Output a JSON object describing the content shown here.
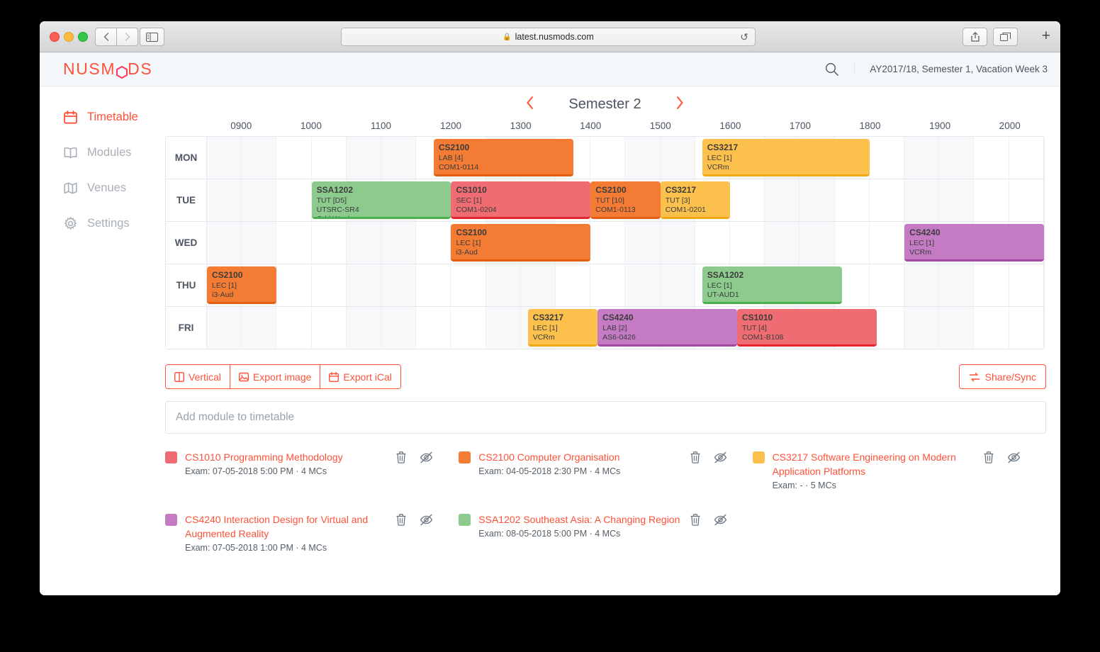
{
  "browser": {
    "url": "latest.nusmods.com",
    "lock_icon": "lock-icon",
    "reload_icon": "reload-icon",
    "back_icon": "back-arrow-icon",
    "forward_icon": "forward-arrow-icon",
    "sidebar_icon": "sidebar-toggle-icon",
    "share_icon": "share-icon",
    "tabs_icon": "show-tabs-icon",
    "new_tab_icon": "plus-icon"
  },
  "header": {
    "logo": "NUSMODS",
    "search_icon": "search-icon",
    "acad_info": "AY2017/18, Semester 1, Vacation Week 3"
  },
  "sidebar": {
    "items": [
      {
        "label": "Timetable",
        "icon": "calendar-icon",
        "active": true
      },
      {
        "label": "Modules",
        "icon": "book-icon",
        "active": false
      },
      {
        "label": "Venues",
        "icon": "map-icon",
        "active": false
      },
      {
        "label": "Settings",
        "icon": "gear-icon",
        "active": false
      }
    ]
  },
  "semester_nav": {
    "prev_icon": "chevron-left-icon",
    "next_icon": "chevron-right-icon",
    "title": "Semester 2"
  },
  "timetable": {
    "time_labels": [
      "0900",
      "1000",
      "1100",
      "1200",
      "1300",
      "1400",
      "1500",
      "1600",
      "1700",
      "1800",
      "1900",
      "2000"
    ],
    "start_hour": 8.5,
    "end_hour": 20.5,
    "days": [
      {
        "label": "MON",
        "lessons": [
          {
            "code": "CS2100",
            "type": "LAB [4]",
            "venue": "COM1-0114",
            "extra": "",
            "start": 11.75,
            "end": 13.75,
            "color": "#f47b33",
            "border": "#e25f12"
          },
          {
            "code": "CS3217",
            "type": "LEC [1]",
            "venue": "VCRm",
            "extra": "",
            "start": 15.6,
            "end": 18.0,
            "color": "#fcc04d",
            "border": "#f0a815"
          }
        ]
      },
      {
        "label": "TUE",
        "lessons": [
          {
            "code": "SSA1202",
            "type": "TUT [D5]",
            "venue": "UTSRC-SR4",
            "extra": "Odd Week",
            "start": 10.0,
            "end": 12.0,
            "color": "#8dca8d",
            "border": "#4caf50"
          },
          {
            "code": "CS1010",
            "type": "SEC [1]",
            "venue": "COM1-0204",
            "extra": "",
            "start": 12.0,
            "end": 14.0,
            "color": "#ef6d72",
            "border": "#e5252d"
          },
          {
            "code": "CS2100",
            "type": "TUT [10]",
            "venue": "COM1-0113",
            "extra": "",
            "start": 14.0,
            "end": 15.0,
            "color": "#f47b33",
            "border": "#e25f12"
          },
          {
            "code": "CS3217",
            "type": "TUT [3]",
            "venue": "COM1-0201",
            "extra": "",
            "start": 15.0,
            "end": 16.0,
            "color": "#fcc04d",
            "border": "#f0a815"
          }
        ]
      },
      {
        "label": "WED",
        "lessons": [
          {
            "code": "CS2100",
            "type": "LEC [1]",
            "venue": "i3-Aud",
            "extra": "",
            "start": 12.0,
            "end": 14.0,
            "color": "#f47b33",
            "border": "#e25f12"
          },
          {
            "code": "CS4240",
            "type": "LEC [1]",
            "venue": "VCRm",
            "extra": "",
            "start": 18.5,
            "end": 20.5,
            "color": "#c47bc4",
            "border": "#a34aa3"
          }
        ]
      },
      {
        "label": "THU",
        "lessons": [
          {
            "code": "CS2100",
            "type": "LEC [1]",
            "venue": "i3-Aud",
            "extra": "",
            "start": 8.5,
            "end": 9.5,
            "color": "#f47b33",
            "border": "#e25f12"
          },
          {
            "code": "SSA1202",
            "type": "LEC [1]",
            "venue": "UT-AUD1",
            "extra": "",
            "start": 15.6,
            "end": 17.6,
            "color": "#8dca8d",
            "border": "#4caf50"
          }
        ]
      },
      {
        "label": "FRI",
        "lessons": [
          {
            "code": "CS3217",
            "type": "LEC [1]",
            "venue": "VCRm",
            "extra": "",
            "start": 13.1,
            "end": 14.1,
            "color": "#fcc04d",
            "border": "#f0a815"
          },
          {
            "code": "CS4240",
            "type": "LAB [2]",
            "venue": "AS6-0426",
            "extra": "",
            "start": 14.1,
            "end": 16.1,
            "color": "#c47bc4",
            "border": "#a34aa3"
          },
          {
            "code": "CS1010",
            "type": "TUT [4]",
            "venue": "COM1-B108",
            "extra": "",
            "start": 16.1,
            "end": 18.1,
            "color": "#ef6d72",
            "border": "#e5252d"
          }
        ]
      }
    ]
  },
  "toolbar": {
    "buttons": [
      {
        "label": "Vertical",
        "icon": "columns-icon"
      },
      {
        "label": "Export image",
        "icon": "image-icon"
      },
      {
        "label": "Export iCal",
        "icon": "calendar-icon"
      }
    ],
    "share_label": "Share/Sync",
    "share_icon": "sync-icon"
  },
  "add_module": {
    "placeholder": "Add module to timetable"
  },
  "modules": [
    {
      "color": "#ef6d72",
      "name": "CS1010 Programming Methodology",
      "exam": "Exam: 07-05-2018 5:00 PM · 4 MCs",
      "delete_icon": "trash-icon",
      "hide_icon": "eye-off-icon"
    },
    {
      "color": "#f47b33",
      "name": "CS2100 Computer Organisation",
      "exam": "Exam: 04-05-2018 2:30 PM · 4 MCs",
      "delete_icon": "trash-icon",
      "hide_icon": "eye-off-icon"
    },
    {
      "color": "#fcc04d",
      "name": "CS3217 Software Engineering on Modern Application Platforms",
      "exam": "Exam: - · 5 MCs",
      "delete_icon": "trash-icon",
      "hide_icon": "eye-off-icon"
    },
    {
      "color": "#c47bc4",
      "name": "CS4240 Interaction Design for Virtual and Augmented Reality",
      "exam": "Exam: 07-05-2018 1:00 PM · 4 MCs",
      "delete_icon": "trash-icon",
      "hide_icon": "eye-off-icon"
    },
    {
      "color": "#8dca8d",
      "name": "SSA1202 Southeast Asia: A Changing Region",
      "exam": "Exam: 08-05-2018 5:00 PM · 4 MCs",
      "delete_icon": "trash-icon",
      "hide_icon": "eye-off-icon"
    }
  ],
  "colors": {
    "accent": "#ff5138",
    "header_bg": "#f5f8fa",
    "text": "#4b5563"
  }
}
